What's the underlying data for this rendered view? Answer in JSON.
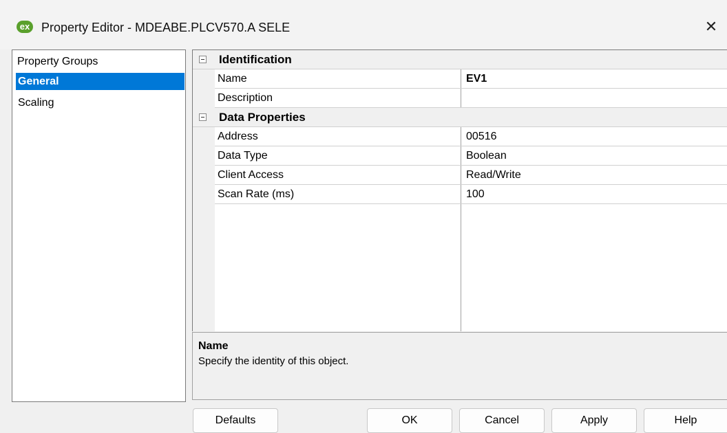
{
  "window": {
    "app_icon_text": "ex",
    "title": "Property Editor - MDEABE.PLCV570.A SELE",
    "close_glyph": "✕"
  },
  "property_groups": {
    "header": "Property Groups",
    "items": [
      {
        "label": "General",
        "selected": true
      },
      {
        "label": "Scaling",
        "selected": false
      }
    ]
  },
  "grid": {
    "categories": [
      {
        "label": "Identification",
        "expanded": true,
        "properties": [
          {
            "name": "Name",
            "value": "EV1",
            "bold": true
          },
          {
            "name": "Description",
            "value": ""
          }
        ]
      },
      {
        "label": "Data Properties",
        "expanded": true,
        "properties": [
          {
            "name": "Address",
            "value": "00516"
          },
          {
            "name": "Data Type",
            "value": "Boolean"
          },
          {
            "name": "Client Access",
            "value": "Read/Write"
          },
          {
            "name": "Scan Rate (ms)",
            "value": "100"
          }
        ]
      }
    ]
  },
  "help": {
    "title": "Name",
    "text": "Specify the identity of this object."
  },
  "buttons": {
    "defaults": "Defaults",
    "ok": "OK",
    "cancel": "Cancel",
    "apply": "Apply",
    "help": "Help"
  },
  "colors": {
    "selection": "#0078d7",
    "app_icon": "#5aa02c"
  }
}
